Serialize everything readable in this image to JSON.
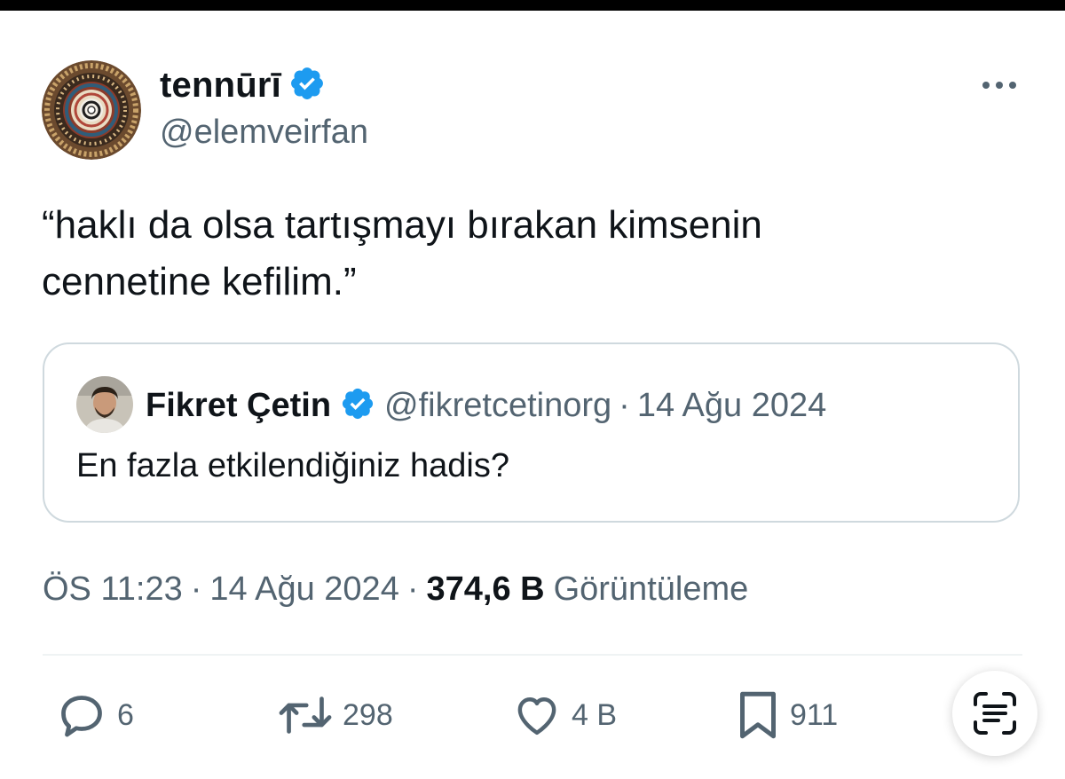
{
  "author": {
    "name": "tennūrī",
    "handle": "@elemveirfan",
    "verified": true,
    "avatar_icon": "ornamental-mandala-avatar"
  },
  "tweet": {
    "text_line1": "“haklı da olsa tartışmayı bırakan kimsenin",
    "text_line2": "cennetine kefilim.”"
  },
  "quoted_tweet": {
    "name": "Fikret Çetin",
    "handle": "@fikretcetinorg",
    "separator": "·",
    "date": "14 Ağu 2024",
    "text": "En fazla etkilendiğiniz hadis?",
    "verified": true
  },
  "meta": {
    "time": "ÖS 11:23",
    "separator": "·",
    "date": "14 Ağu 2024",
    "views_count": "374,6 B",
    "views_label": "Görüntüleme"
  },
  "actions": {
    "replies": "6",
    "retweets": "298",
    "likes": "4 B",
    "bookmarks": "911"
  },
  "colors": {
    "text_primary": "#0f1419",
    "text_secondary": "#536471",
    "verified_blue": "#1d9bf0",
    "border": "#cfd9de"
  }
}
